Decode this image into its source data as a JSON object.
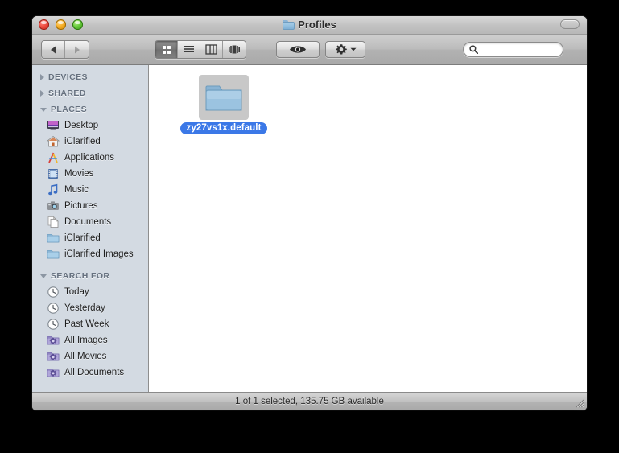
{
  "window": {
    "title": "Profiles",
    "title_icon": "folder-icon",
    "controls": {
      "close": "close-button",
      "minimize": "minimize-button",
      "zoom": "zoom-button"
    },
    "toolbar_toggle_label": ""
  },
  "toolbar": {
    "back_label": "Back",
    "forward_label": "Forward",
    "view_modes": [
      {
        "name": "icon-view",
        "label": "Icon View",
        "active": true
      },
      {
        "name": "list-view",
        "label": "List View",
        "active": false
      },
      {
        "name": "column-view",
        "label": "Column View",
        "active": false
      },
      {
        "name": "coverflow-view",
        "label": "Cover Flow View",
        "active": false
      }
    ],
    "quicklook_label": "Quick Look",
    "action_label": "Action",
    "search": {
      "value": "",
      "placeholder": ""
    }
  },
  "sidebar": {
    "sections": [
      {
        "title": "DEVICES",
        "expanded": false,
        "items": []
      },
      {
        "title": "SHARED",
        "expanded": false,
        "items": []
      },
      {
        "title": "PLACES",
        "expanded": true,
        "items": [
          {
            "label": "Desktop",
            "icon": "desktop-icon"
          },
          {
            "label": "iClarified",
            "icon": "home-icon"
          },
          {
            "label": "Applications",
            "icon": "applications-icon"
          },
          {
            "label": "Movies",
            "icon": "movies-icon"
          },
          {
            "label": "Music",
            "icon": "music-icon"
          },
          {
            "label": "Pictures",
            "icon": "pictures-icon"
          },
          {
            "label": "Documents",
            "icon": "documents-icon"
          },
          {
            "label": "iClarified",
            "icon": "folder-icon"
          },
          {
            "label": "iClarified Images",
            "icon": "folder-icon"
          }
        ]
      },
      {
        "title": "SEARCH FOR",
        "expanded": true,
        "items": [
          {
            "label": "Today",
            "icon": "clock-icon"
          },
          {
            "label": "Yesterday",
            "icon": "clock-icon"
          },
          {
            "label": "Past Week",
            "icon": "clock-icon"
          },
          {
            "label": "All Images",
            "icon": "smart-folder-icon"
          },
          {
            "label": "All Movies",
            "icon": "smart-folder-icon"
          },
          {
            "label": "All Documents",
            "icon": "smart-folder-icon"
          }
        ]
      }
    ]
  },
  "content": {
    "files": [
      {
        "name": "zy27vs1x.default",
        "icon": "folder-icon",
        "selected": true
      }
    ]
  },
  "statusbar": {
    "text": "1 of 1 selected, 135.75 GB available"
  },
  "colors": {
    "selection_blue": "#3b78e7",
    "sidebar_bg": "#d3dae2",
    "content_bg": "#ffffff",
    "header_text": "#66717f"
  }
}
